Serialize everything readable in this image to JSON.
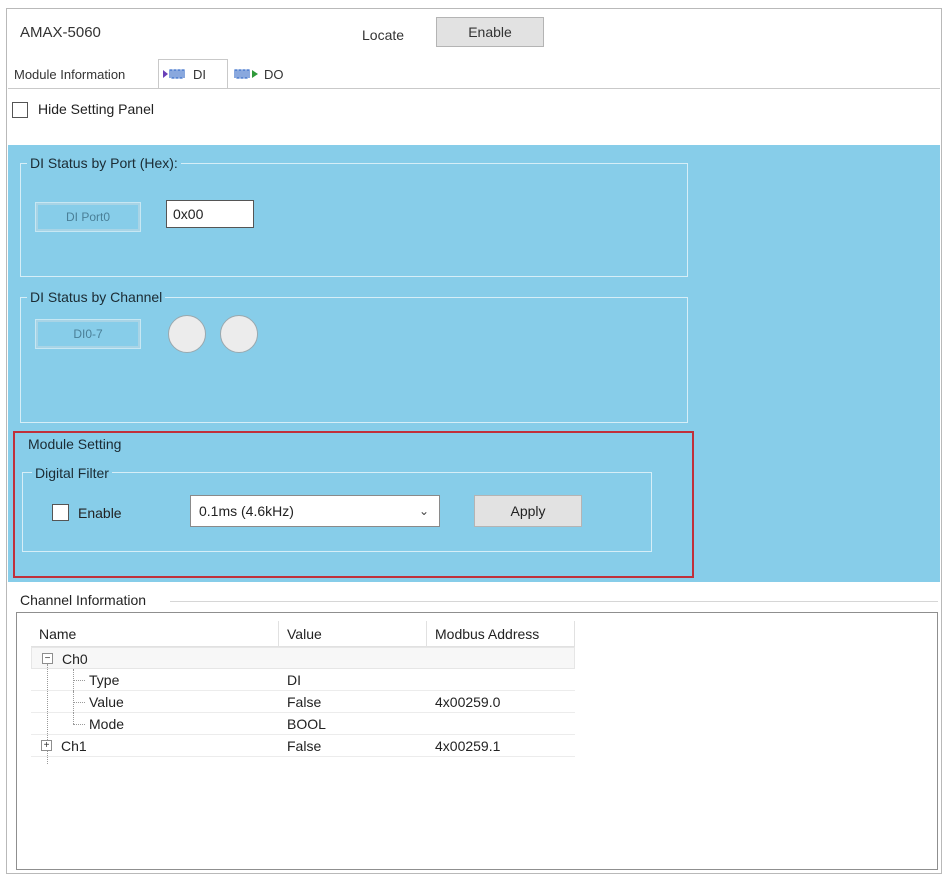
{
  "header": {
    "title": "AMAX-5060",
    "locate_label": "Locate",
    "enable_button": "Enable"
  },
  "tabs": [
    {
      "label": "Module Information",
      "icon": "none"
    },
    {
      "label": "DI",
      "icon": "di-signal-icon",
      "active": true
    },
    {
      "label": "DO",
      "icon": "do-signal-icon"
    }
  ],
  "hide_panel": {
    "label": "Hide Setting Panel",
    "checked": false
  },
  "colors": {
    "panel_bg": "#87cde9",
    "highlight_border": "#c0303a"
  },
  "di_port": {
    "group_title": "DI Status by Port (Hex):",
    "port_label": "DI Port0",
    "value": "0x00"
  },
  "di_channel": {
    "group_title": "DI Status by Channel",
    "range_label": "DI0-7",
    "leds": [
      "off",
      "off"
    ]
  },
  "module_setting": {
    "title": "Module Setting",
    "digital_filter": {
      "title": "Digital Filter",
      "enable_label": "Enable",
      "enable_checked": false,
      "selected_option": "0.1ms (4.6kHz)",
      "apply_button": "Apply"
    }
  },
  "channel_info": {
    "title": "Channel Information",
    "columns": [
      "Name",
      "Value",
      "Modbus Address"
    ],
    "rows": {
      "ch0": {
        "name": "Ch0",
        "value": "",
        "address": "",
        "expanded": true
      },
      "type": {
        "name": "Type",
        "value": "DI",
        "address": ""
      },
      "val": {
        "name": "Value",
        "value": "False",
        "address": "4x00259.0"
      },
      "mode": {
        "name": "Mode",
        "value": "BOOL",
        "address": ""
      },
      "ch1": {
        "name": "Ch1",
        "value": "False",
        "address": "4x00259.1",
        "expanded": false
      }
    }
  }
}
